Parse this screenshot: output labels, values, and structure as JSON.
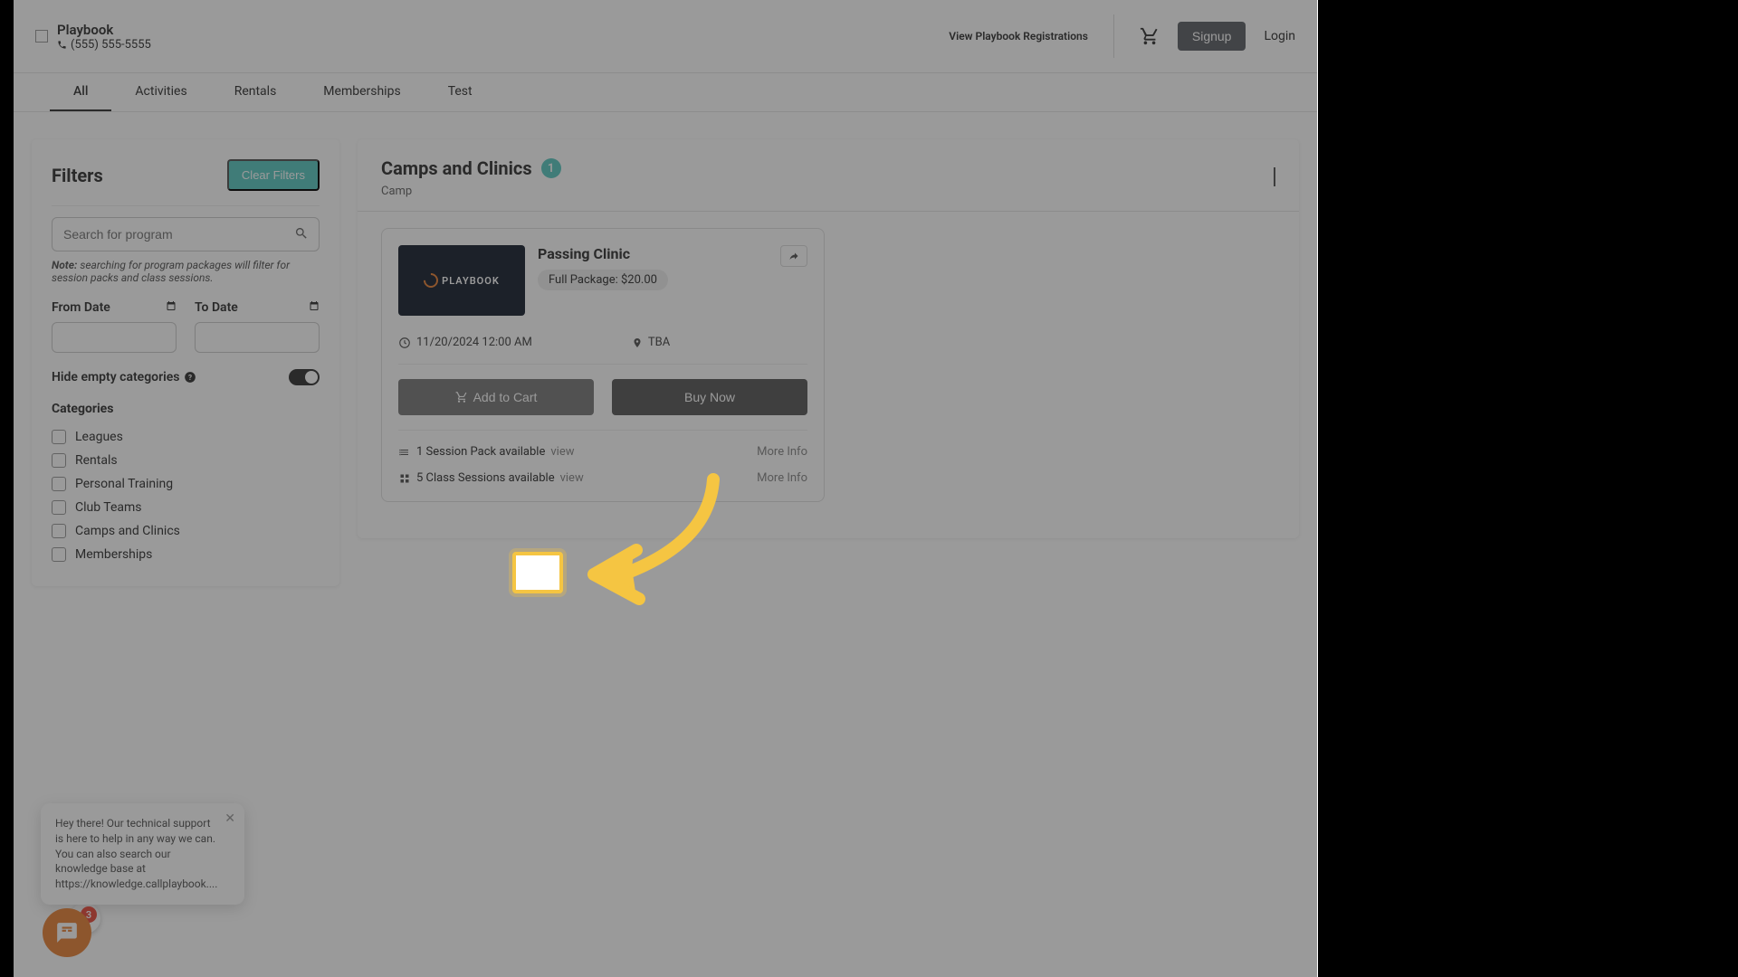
{
  "header": {
    "brand_name": "Playbook",
    "phone": "(555) 555-5555",
    "view_registrations": "View Playbook Registrations",
    "signup": "Signup",
    "login": "Login"
  },
  "tabs": {
    "all": "All",
    "activities": "Activities",
    "rentals": "Rentals",
    "memberships": "Memberships",
    "test": "Test"
  },
  "filters": {
    "title": "Filters",
    "clear": "Clear Filters",
    "search_placeholder": "Search for program",
    "note_label": "Note:",
    "note_text": "searching for program packages will filter for session packs and class sessions.",
    "from_date": "From Date",
    "to_date": "To Date",
    "hide_empty": "Hide empty categories",
    "categories_title": "Categories",
    "categories": {
      "leagues": "Leagues",
      "rentals": "Rentals",
      "personal_training": "Personal Training",
      "club_teams": "Club Teams",
      "camps_clinics": "Camps and Clinics",
      "memberships": "Memberships"
    }
  },
  "section": {
    "title": "Camps and Clinics",
    "count": "1",
    "subtitle": "Camp"
  },
  "card": {
    "logo_text": "PLAYBOOK",
    "title": "Passing Clinic",
    "price": "Full Package: $20.00",
    "date": "11/20/2024 12:00 AM",
    "location": "TBA",
    "add_to_cart": "Add to Cart",
    "buy_now": "Buy Now",
    "session_pack": "1 Session Pack available",
    "session_pack_view": "view",
    "class_sessions": "5 Class Sessions available",
    "class_sessions_view": "view",
    "more_info": "More Info"
  },
  "chat": {
    "text": "Hey there! Our technical support is here to help in any way we can. You can also search our knowledge base at https://knowledge.callplaybook....",
    "badge": "3"
  }
}
